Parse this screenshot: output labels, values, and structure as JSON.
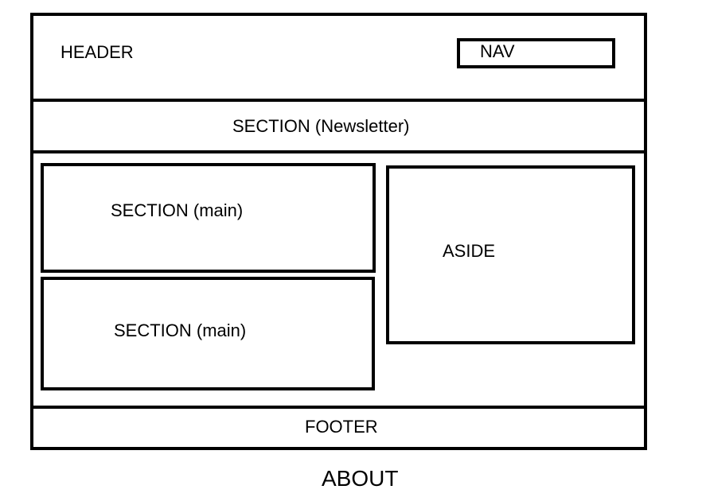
{
  "diagram": {
    "header_label": "HEADER",
    "nav_label": "NAV",
    "newsletter_label": "SECTION (Newsletter)",
    "main_section_1_label": "SECTION (main)",
    "main_section_2_label": "SECTION (main)",
    "aside_label": "ASIDE",
    "footer_label": "FOOTER",
    "caption": "ABOUT"
  }
}
